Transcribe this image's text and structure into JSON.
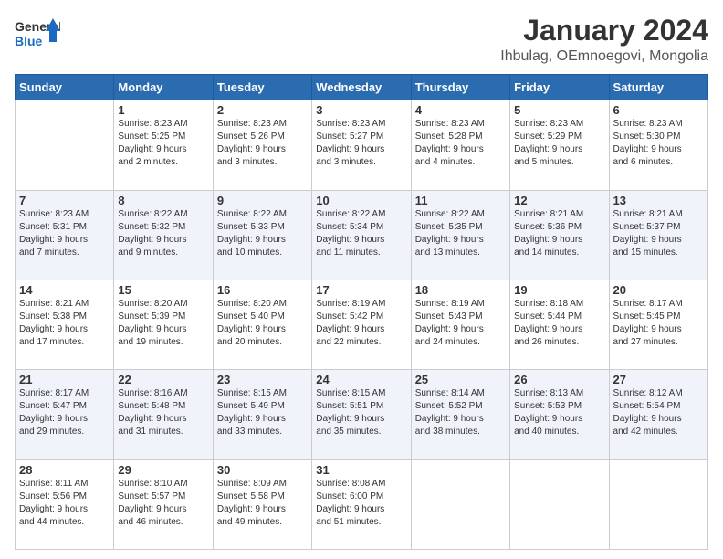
{
  "logo": {
    "text_general": "General",
    "text_blue": "Blue"
  },
  "header": {
    "month": "January 2024",
    "location": "Ihbulag, OEmnoegovi, Mongolia"
  },
  "weekdays": [
    "Sunday",
    "Monday",
    "Tuesday",
    "Wednesday",
    "Thursday",
    "Friday",
    "Saturday"
  ],
  "weeks": [
    [
      {
        "day": "",
        "info": ""
      },
      {
        "day": "1",
        "info": "Sunrise: 8:23 AM\nSunset: 5:25 PM\nDaylight: 9 hours\nand 2 minutes."
      },
      {
        "day": "2",
        "info": "Sunrise: 8:23 AM\nSunset: 5:26 PM\nDaylight: 9 hours\nand 3 minutes."
      },
      {
        "day": "3",
        "info": "Sunrise: 8:23 AM\nSunset: 5:27 PM\nDaylight: 9 hours\nand 3 minutes."
      },
      {
        "day": "4",
        "info": "Sunrise: 8:23 AM\nSunset: 5:28 PM\nDaylight: 9 hours\nand 4 minutes."
      },
      {
        "day": "5",
        "info": "Sunrise: 8:23 AM\nSunset: 5:29 PM\nDaylight: 9 hours\nand 5 minutes."
      },
      {
        "day": "6",
        "info": "Sunrise: 8:23 AM\nSunset: 5:30 PM\nDaylight: 9 hours\nand 6 minutes."
      }
    ],
    [
      {
        "day": "7",
        "info": "Sunrise: 8:23 AM\nSunset: 5:31 PM\nDaylight: 9 hours\nand 7 minutes."
      },
      {
        "day": "8",
        "info": "Sunrise: 8:22 AM\nSunset: 5:32 PM\nDaylight: 9 hours\nand 9 minutes."
      },
      {
        "day": "9",
        "info": "Sunrise: 8:22 AM\nSunset: 5:33 PM\nDaylight: 9 hours\nand 10 minutes."
      },
      {
        "day": "10",
        "info": "Sunrise: 8:22 AM\nSunset: 5:34 PM\nDaylight: 9 hours\nand 11 minutes."
      },
      {
        "day": "11",
        "info": "Sunrise: 8:22 AM\nSunset: 5:35 PM\nDaylight: 9 hours\nand 13 minutes."
      },
      {
        "day": "12",
        "info": "Sunrise: 8:21 AM\nSunset: 5:36 PM\nDaylight: 9 hours\nand 14 minutes."
      },
      {
        "day": "13",
        "info": "Sunrise: 8:21 AM\nSunset: 5:37 PM\nDaylight: 9 hours\nand 15 minutes."
      }
    ],
    [
      {
        "day": "14",
        "info": "Sunrise: 8:21 AM\nSunset: 5:38 PM\nDaylight: 9 hours\nand 17 minutes."
      },
      {
        "day": "15",
        "info": "Sunrise: 8:20 AM\nSunset: 5:39 PM\nDaylight: 9 hours\nand 19 minutes."
      },
      {
        "day": "16",
        "info": "Sunrise: 8:20 AM\nSunset: 5:40 PM\nDaylight: 9 hours\nand 20 minutes."
      },
      {
        "day": "17",
        "info": "Sunrise: 8:19 AM\nSunset: 5:42 PM\nDaylight: 9 hours\nand 22 minutes."
      },
      {
        "day": "18",
        "info": "Sunrise: 8:19 AM\nSunset: 5:43 PM\nDaylight: 9 hours\nand 24 minutes."
      },
      {
        "day": "19",
        "info": "Sunrise: 8:18 AM\nSunset: 5:44 PM\nDaylight: 9 hours\nand 26 minutes."
      },
      {
        "day": "20",
        "info": "Sunrise: 8:17 AM\nSunset: 5:45 PM\nDaylight: 9 hours\nand 27 minutes."
      }
    ],
    [
      {
        "day": "21",
        "info": "Sunrise: 8:17 AM\nSunset: 5:47 PM\nDaylight: 9 hours\nand 29 minutes."
      },
      {
        "day": "22",
        "info": "Sunrise: 8:16 AM\nSunset: 5:48 PM\nDaylight: 9 hours\nand 31 minutes."
      },
      {
        "day": "23",
        "info": "Sunrise: 8:15 AM\nSunset: 5:49 PM\nDaylight: 9 hours\nand 33 minutes."
      },
      {
        "day": "24",
        "info": "Sunrise: 8:15 AM\nSunset: 5:51 PM\nDaylight: 9 hours\nand 35 minutes."
      },
      {
        "day": "25",
        "info": "Sunrise: 8:14 AM\nSunset: 5:52 PM\nDaylight: 9 hours\nand 38 minutes."
      },
      {
        "day": "26",
        "info": "Sunrise: 8:13 AM\nSunset: 5:53 PM\nDaylight: 9 hours\nand 40 minutes."
      },
      {
        "day": "27",
        "info": "Sunrise: 8:12 AM\nSunset: 5:54 PM\nDaylight: 9 hours\nand 42 minutes."
      }
    ],
    [
      {
        "day": "28",
        "info": "Sunrise: 8:11 AM\nSunset: 5:56 PM\nDaylight: 9 hours\nand 44 minutes."
      },
      {
        "day": "29",
        "info": "Sunrise: 8:10 AM\nSunset: 5:57 PM\nDaylight: 9 hours\nand 46 minutes."
      },
      {
        "day": "30",
        "info": "Sunrise: 8:09 AM\nSunset: 5:58 PM\nDaylight: 9 hours\nand 49 minutes."
      },
      {
        "day": "31",
        "info": "Sunrise: 8:08 AM\nSunset: 6:00 PM\nDaylight: 9 hours\nand 51 minutes."
      },
      {
        "day": "",
        "info": ""
      },
      {
        "day": "",
        "info": ""
      },
      {
        "day": "",
        "info": ""
      }
    ]
  ]
}
